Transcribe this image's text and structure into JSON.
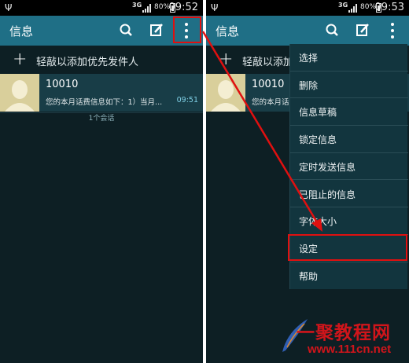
{
  "status": {
    "network": "3G",
    "battery": "80%",
    "time_left": "09:52",
    "time_right": "09:53"
  },
  "actionbar": {
    "title": "信息"
  },
  "compose": {
    "add_priority": "轻敲以添加优先发件人"
  },
  "conversation": {
    "name": "10010",
    "snippet": "您的本月话费信息如下：1）当月...",
    "time": "09:51",
    "count": "1个会话"
  },
  "menu": {
    "items": [
      "选择",
      "删除",
      "信息草稿",
      "锁定信息",
      "定时发送信息",
      "已阻止的信息",
      "字体大小",
      "设定",
      "帮助"
    ]
  },
  "highlight_color": "#e01010",
  "watermark": {
    "title": "一聚教程网",
    "url": "www.111cn.net"
  }
}
